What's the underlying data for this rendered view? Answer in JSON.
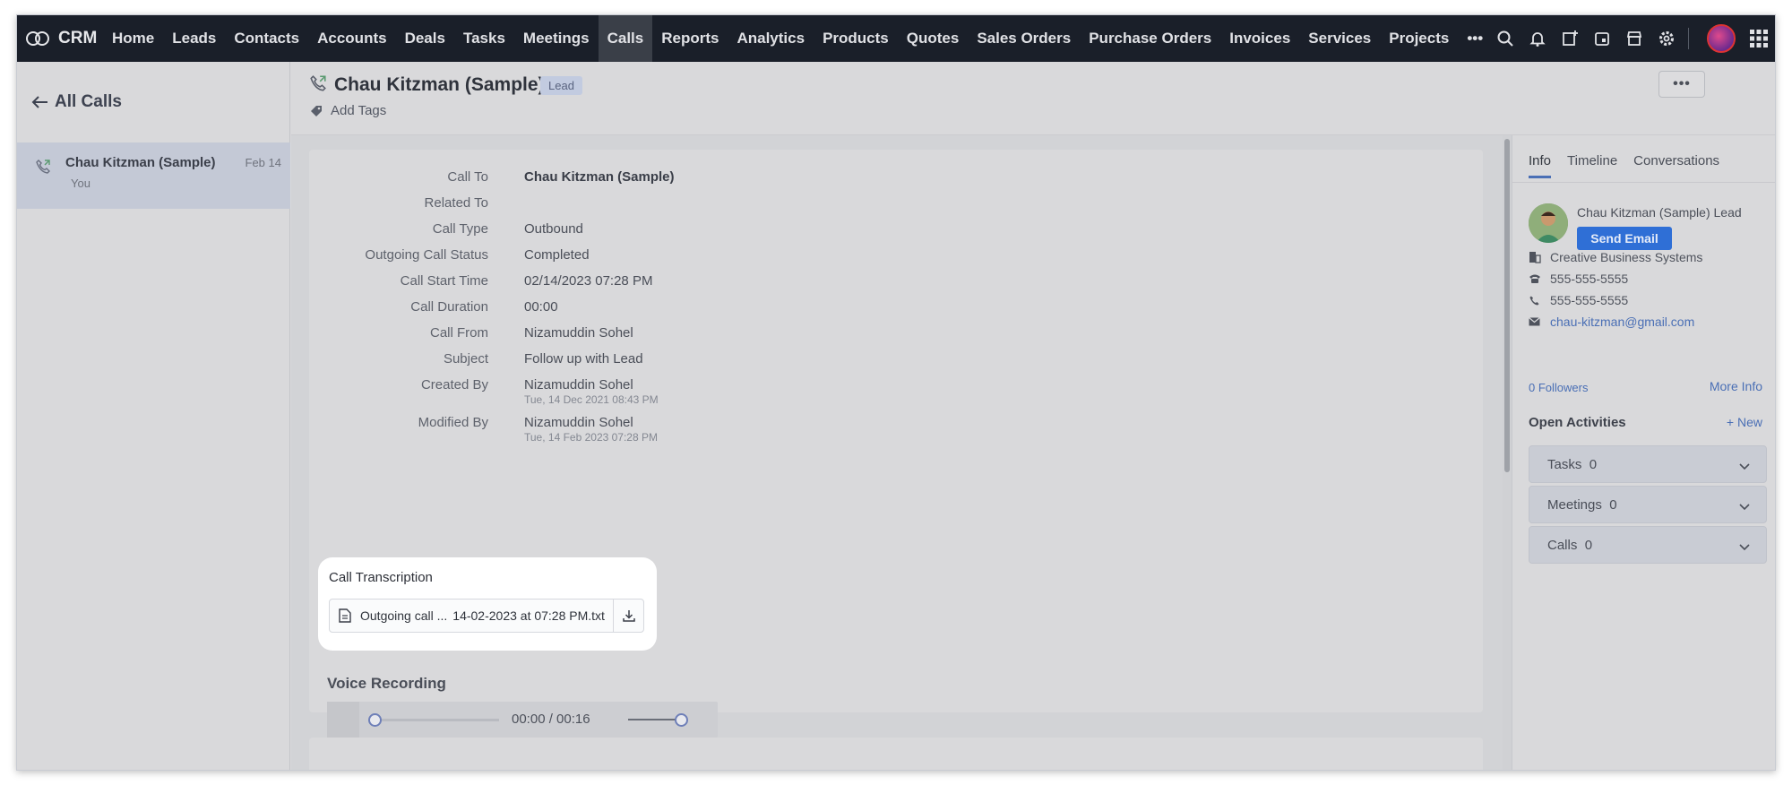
{
  "topnav": {
    "brand": "CRM",
    "items": [
      "Home",
      "Leads",
      "Contacts",
      "Accounts",
      "Deals",
      "Tasks",
      "Meetings",
      "Calls",
      "Reports",
      "Analytics",
      "Products",
      "Quotes",
      "Sales Orders",
      "Purchase Orders",
      "Invoices",
      "Services",
      "Projects"
    ],
    "active_item": "Calls",
    "more": "•••",
    "right_icons": [
      "search-icon",
      "bell-icon",
      "add-icon",
      "calendar-icon",
      "store-icon",
      "gear-icon",
      "avatar",
      "apps-grid-icon"
    ]
  },
  "left": {
    "back_label": "All Calls",
    "calls": [
      {
        "name": "Chau Kitzman (Sample)",
        "date": "Feb 14",
        "sub": "You"
      }
    ]
  },
  "header": {
    "title": "Chau Kitzman (Sample)",
    "badge": "Lead",
    "add_tags": "Add Tags",
    "more": "•••"
  },
  "details": {
    "call_to_label": "Call To",
    "call_to": "Chau Kitzman (Sample)",
    "related_to_label": "Related To",
    "related_to": "",
    "call_type_label": "Call Type",
    "call_type": "Outbound",
    "status_label": "Outgoing Call Status",
    "status": "Completed",
    "start_label": "Call Start Time",
    "start": "02/14/2023 07:28 PM",
    "duration_label": "Call Duration",
    "duration": "00:00",
    "from_label": "Call From",
    "from": "Nizamuddin Sohel",
    "subject_label": "Subject",
    "subject": "Follow up with Lead",
    "created_label": "Created By",
    "created_by": "Nizamuddin Sohel",
    "created_at": "Tue, 14 Dec 2021 08:43 PM",
    "modified_label": "Modified By",
    "modified_by": "Nizamuddin Sohel",
    "modified_at": "Tue, 14 Feb 2023 07:28 PM"
  },
  "transcription": {
    "title": "Call Transcription",
    "file_prefix": "Outgoing call ...",
    "file_suffix": "14-02-2023 at 07:28 PM.txt"
  },
  "recording": {
    "title": "Voice Recording",
    "time": "00:00 / 00:16",
    "progress": 0
  },
  "right": {
    "tabs": [
      "Info",
      "Timeline",
      "Conversations"
    ],
    "active_tab": "Info",
    "contact_name": "Chau Kitzman (Sample) Lead",
    "send_email": "Send Email",
    "company": "Creative Business Systems",
    "phone1": "555-555-5555",
    "phone2": "555-555-5555",
    "email": "chau-kitzman@gmail.com",
    "followers": "0 Followers",
    "more_info": "More Info",
    "open_activities": "Open Activities",
    "new": "+ New",
    "activities": [
      {
        "label": "Tasks",
        "count": "0"
      },
      {
        "label": "Meetings",
        "count": "0"
      },
      {
        "label": "Calls",
        "count": "0"
      }
    ]
  },
  "colors": {
    "nav_bg": "#1a1f29",
    "accent": "#2f6fd6",
    "link": "#4a6fb5"
  }
}
